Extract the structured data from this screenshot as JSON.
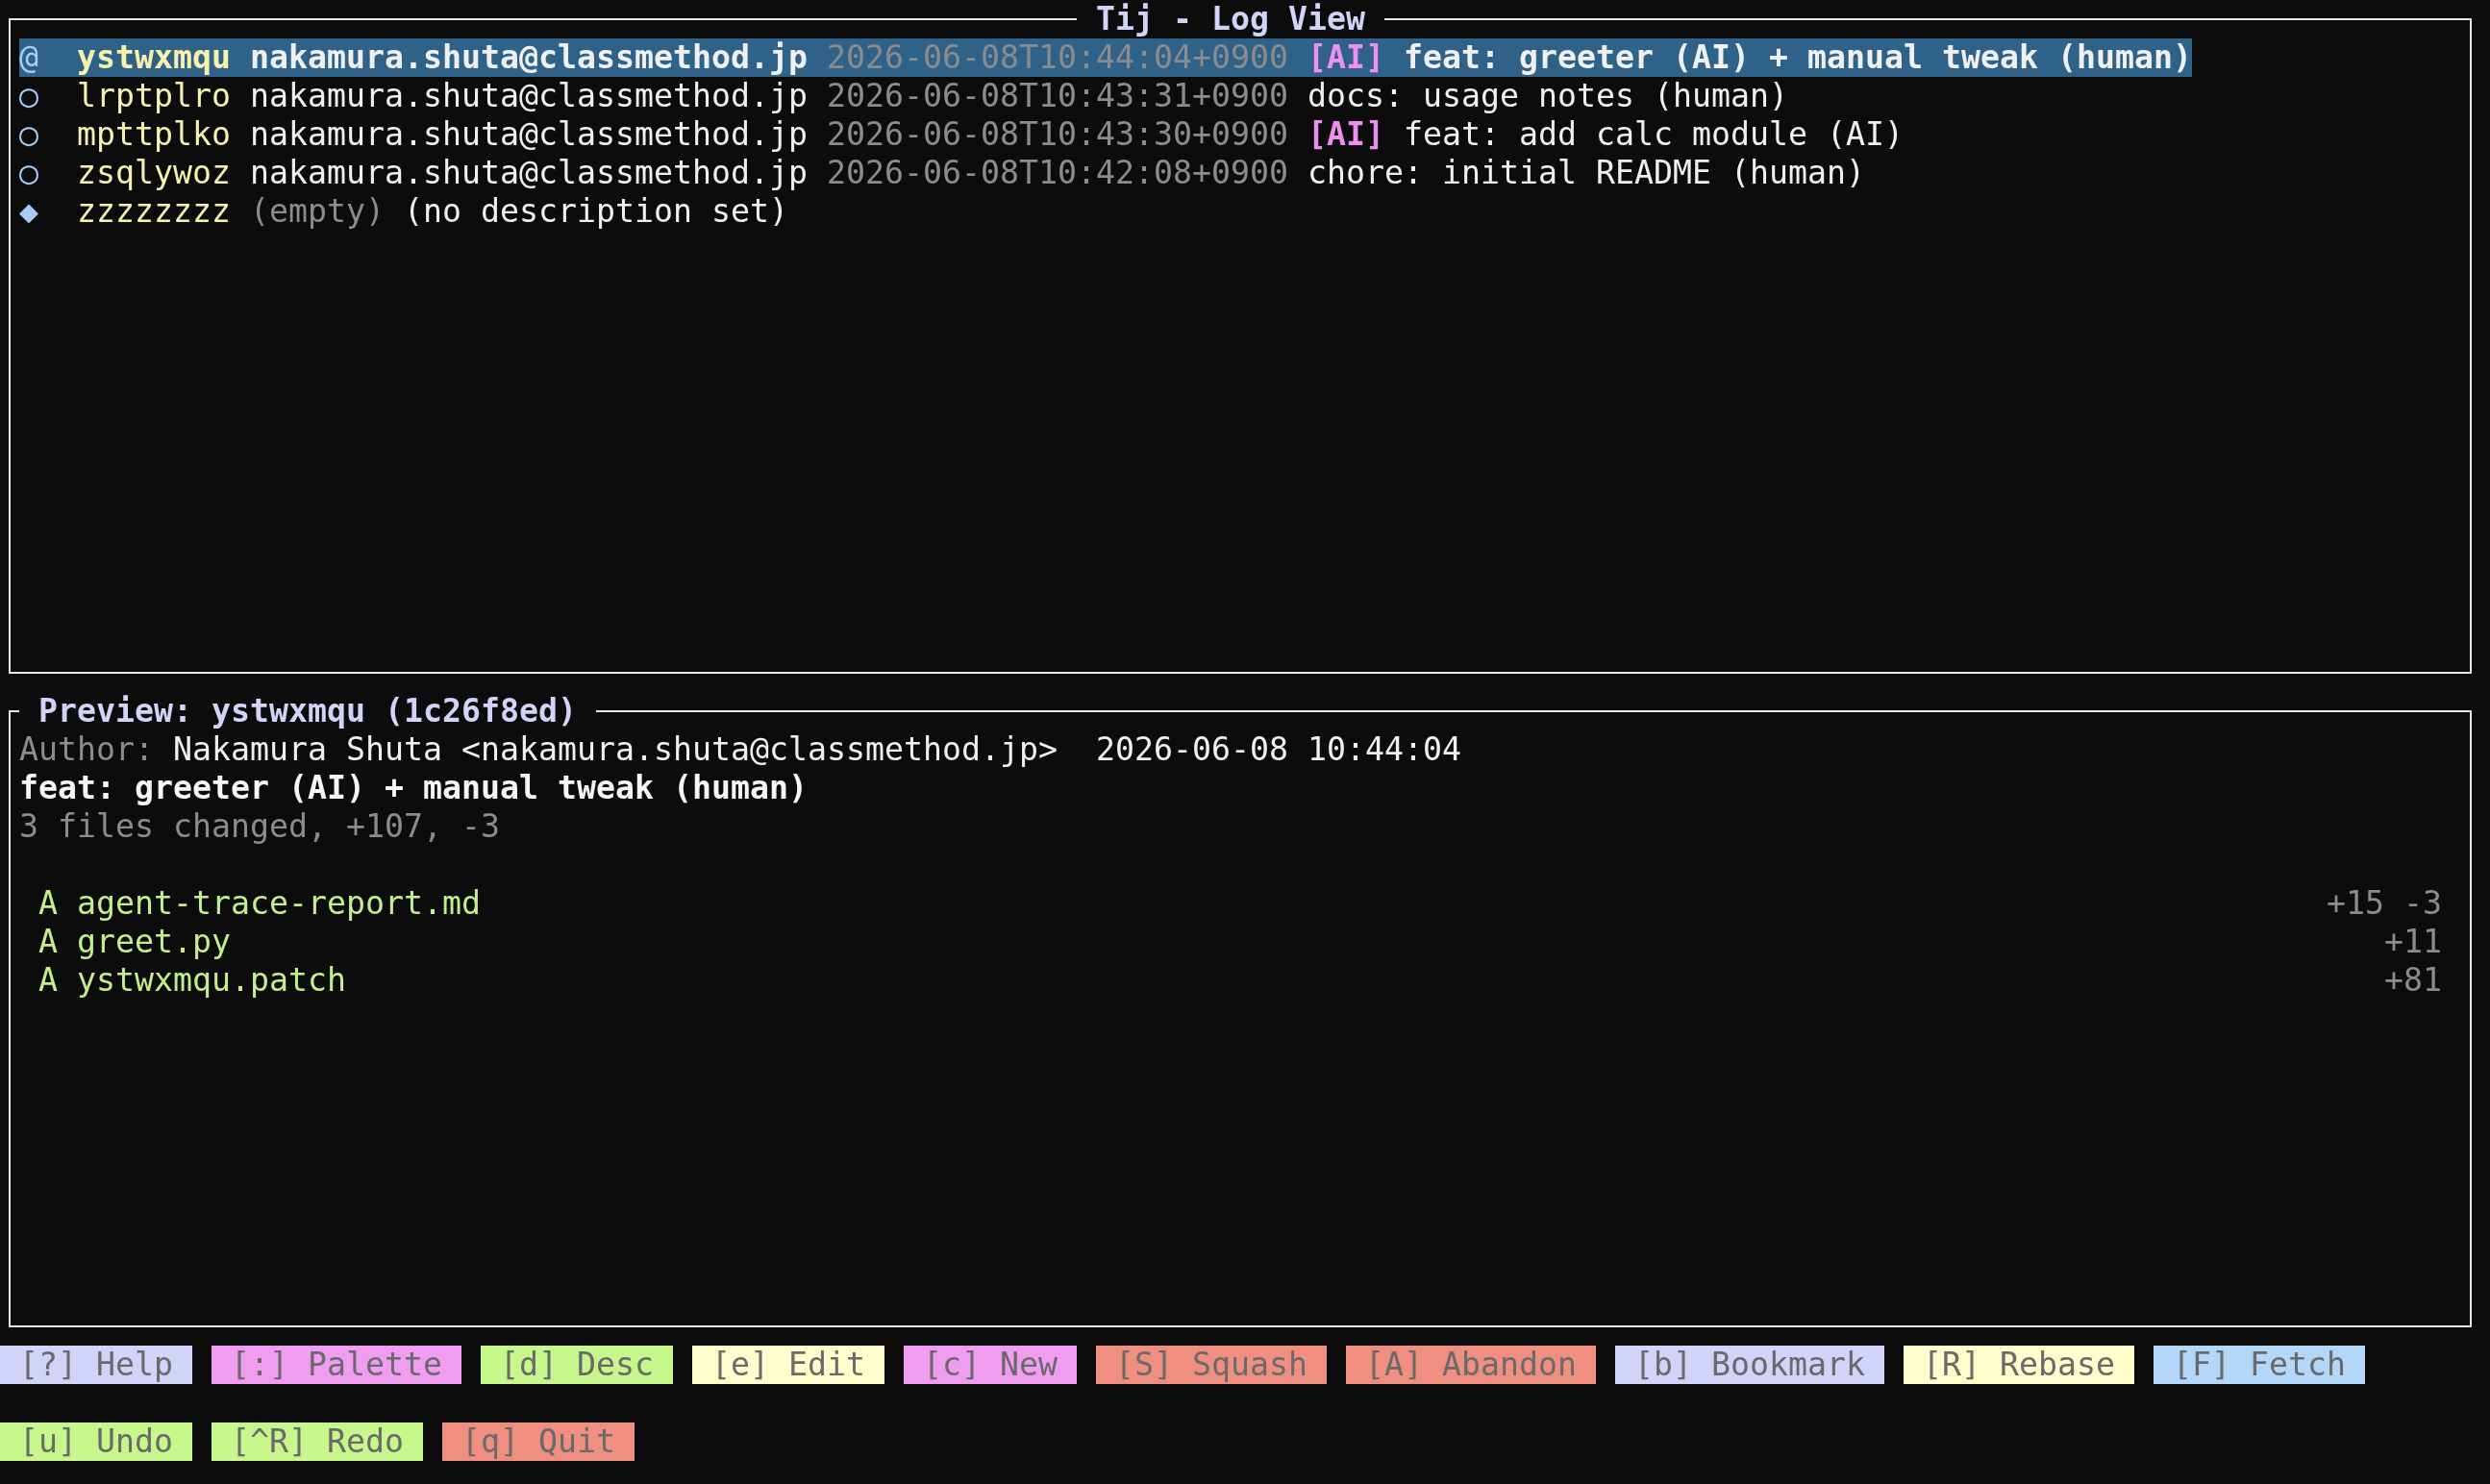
{
  "window": {
    "title": "Tij - Log View"
  },
  "log": {
    "rows": [
      {
        "graph": "@",
        "change_id": "ystwxmqu",
        "author": "nakamura.shuta@classmethod.jp",
        "timestamp": "2026-06-08T10:44:04+0900",
        "tag": "[AI]",
        "description": "feat: greeter (AI) + manual tweak (human)",
        "selected": true
      },
      {
        "graph": "○",
        "change_id": "lrptplro",
        "author": "nakamura.shuta@classmethod.jp",
        "timestamp": "2026-06-08T10:43:31+0900",
        "description": "docs: usage notes (human)",
        "selected": false
      },
      {
        "graph": "○",
        "change_id": "mpttplko",
        "author": "nakamura.shuta@classmethod.jp",
        "timestamp": "2026-06-08T10:43:30+0900",
        "tag": "[AI]",
        "description": "feat: add calc module (AI)",
        "selected": false
      },
      {
        "graph": "○",
        "change_id": "zsqlywoz",
        "author": "nakamura.shuta@classmethod.jp",
        "timestamp": "2026-06-08T10:42:08+0900",
        "description": "chore: initial README (human)",
        "selected": false
      },
      {
        "graph": "◆",
        "change_id": "zzzzzzzz",
        "status": "(empty)",
        "description": "(no description set)",
        "selected": false
      }
    ]
  },
  "preview": {
    "title": "Preview: ystwxmqu (1c26f8ed)",
    "author_label": "Author:",
    "author": "Nakamura Shuta <nakamura.shuta@classmethod.jp>",
    "date": "2026-06-08 10:44:04",
    "description": "feat: greeter (AI) + manual tweak (human)",
    "summary": "3 files changed, +107, -3",
    "files": [
      {
        "status": "A",
        "path": "agent-trace-report.md",
        "stats": "+15 -3"
      },
      {
        "status": "A",
        "path": "greet.py",
        "stats": "+11"
      },
      {
        "status": "A",
        "path": "ystwxmqu.patch",
        "stats": "+81"
      }
    ]
  },
  "key_hints": [
    {
      "label": "[?] Help",
      "color": "#d2d3f9"
    },
    {
      "label": "[:] Palette",
      "color": "#f09cf1"
    },
    {
      "label": "[d] Desc",
      "color": "#c7f68b"
    },
    {
      "label": "[e] Edit",
      "color": "#fffdcb"
    },
    {
      "label": "[c] New",
      "color": "#f09cf1"
    },
    {
      "label": "[S] Squash",
      "color": "#f08f80"
    },
    {
      "label": "[A] Abandon",
      "color": "#f08f80"
    },
    {
      "label": "[b] Bookmark",
      "color": "#d2d3f9"
    },
    {
      "label": "[R] Rebase",
      "color": "#fffdcb"
    },
    {
      "label": "[F] Fetch",
      "color": "#b3d7f9"
    },
    {
      "label": "[u] Undo",
      "color": "#c7f68b"
    },
    {
      "label": "[^R] Redo",
      "color": "#c7f68b"
    },
    {
      "label": "[q] Quit",
      "color": "#f08f80"
    }
  ]
}
